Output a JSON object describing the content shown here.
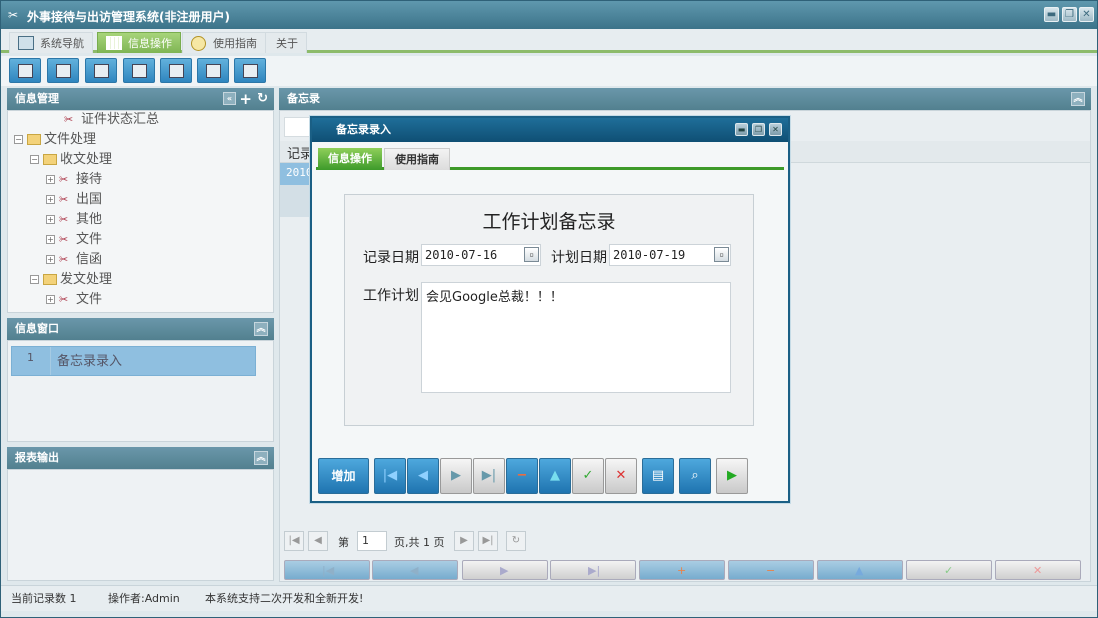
{
  "app": {
    "title": "外事接待与出访管理系统(非注册用户)"
  },
  "menu_tabs": [
    {
      "label": "系统导航"
    },
    {
      "label": "信息操作"
    },
    {
      "label": "使用指南"
    },
    {
      "label": "关于"
    }
  ],
  "toolbar": {
    "buttons": [
      "search-icon",
      "open-icon",
      "document-icon",
      "users-icon",
      "window-icon",
      "export-icon",
      "print-icon"
    ]
  },
  "left": {
    "info_mgmt": {
      "title": "信息管理",
      "tree": [
        {
          "label": "证件状态汇总",
          "level": 3
        },
        {
          "label": "文件处理",
          "level": 0
        },
        {
          "label": "收文处理",
          "level": 1
        },
        {
          "label": "接待",
          "level": 2
        },
        {
          "label": "出国",
          "level": 2
        },
        {
          "label": "其他",
          "level": 2
        },
        {
          "label": "文件",
          "level": 2
        },
        {
          "label": "信函",
          "level": 2
        },
        {
          "label": "发文处理",
          "level": 1
        },
        {
          "label": "文件",
          "level": 2
        }
      ]
    },
    "info_window": {
      "title": "信息窗口",
      "rows": [
        {
          "num": "1",
          "label": "备忘录录入"
        }
      ]
    },
    "report": {
      "title": "报表输出"
    }
  },
  "main": {
    "title": "备忘录",
    "grid_header": "记录",
    "grid_first_cell": "2010",
    "pager": {
      "page_label": "第",
      "page_value": "1",
      "total_label": "页,共 1 页"
    }
  },
  "modal": {
    "title": "备忘录录入",
    "tabs": [
      {
        "label": "信息操作"
      },
      {
        "label": "使用指南"
      }
    ],
    "form_title": "工作计划备忘录",
    "record_date_label": "记录日期",
    "record_date": "2010-07-16",
    "plan_date_label": "计划日期",
    "plan_date": "2010-07-19",
    "plan_label": "工作计划",
    "plan_text": "会见Google总裁！！！",
    "add_label": "增加"
  },
  "status": {
    "record_count": "当前记录数 1",
    "operator": "操作者:Admin",
    "message": "本系统支持二次开发和全新开发!"
  }
}
